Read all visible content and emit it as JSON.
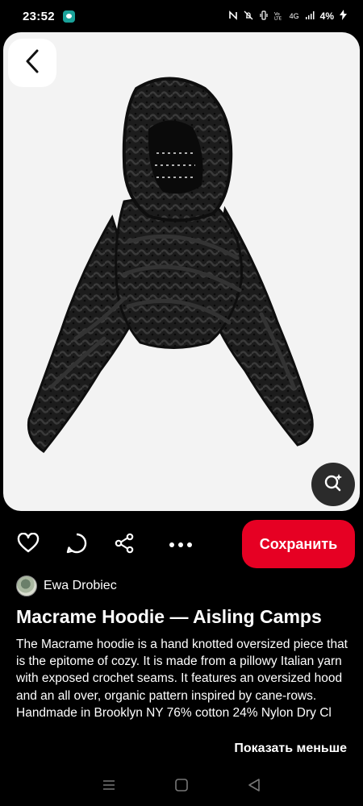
{
  "status_bar": {
    "time": "23:52",
    "network": "4G",
    "battery": "4%"
  },
  "pin": {
    "title": "Macrame Hoodie — Aisling Camps",
    "description": "The Macrame hoodie is a hand knotted oversized piece that is the epitome of cozy. It is made from a pillowy Italian yarn with exposed crochet seams. It features an oversized hood and an all over, organic pattern inspired by cane-rows. Handmade in Brooklyn NY 76% cotton 24% Nylon Dry Cl",
    "show_less_label": "Показать меньше",
    "image_icon": "hoodie-image"
  },
  "author": {
    "name": "Ewa Drobiec"
  },
  "actions": {
    "save_label": "Сохранить",
    "icons": [
      "heart-icon",
      "comment-icon",
      "share-icon",
      "more-icon"
    ]
  },
  "colors": {
    "save_button": "#e60023",
    "background": "#000000",
    "card": "#f3f3f3"
  }
}
